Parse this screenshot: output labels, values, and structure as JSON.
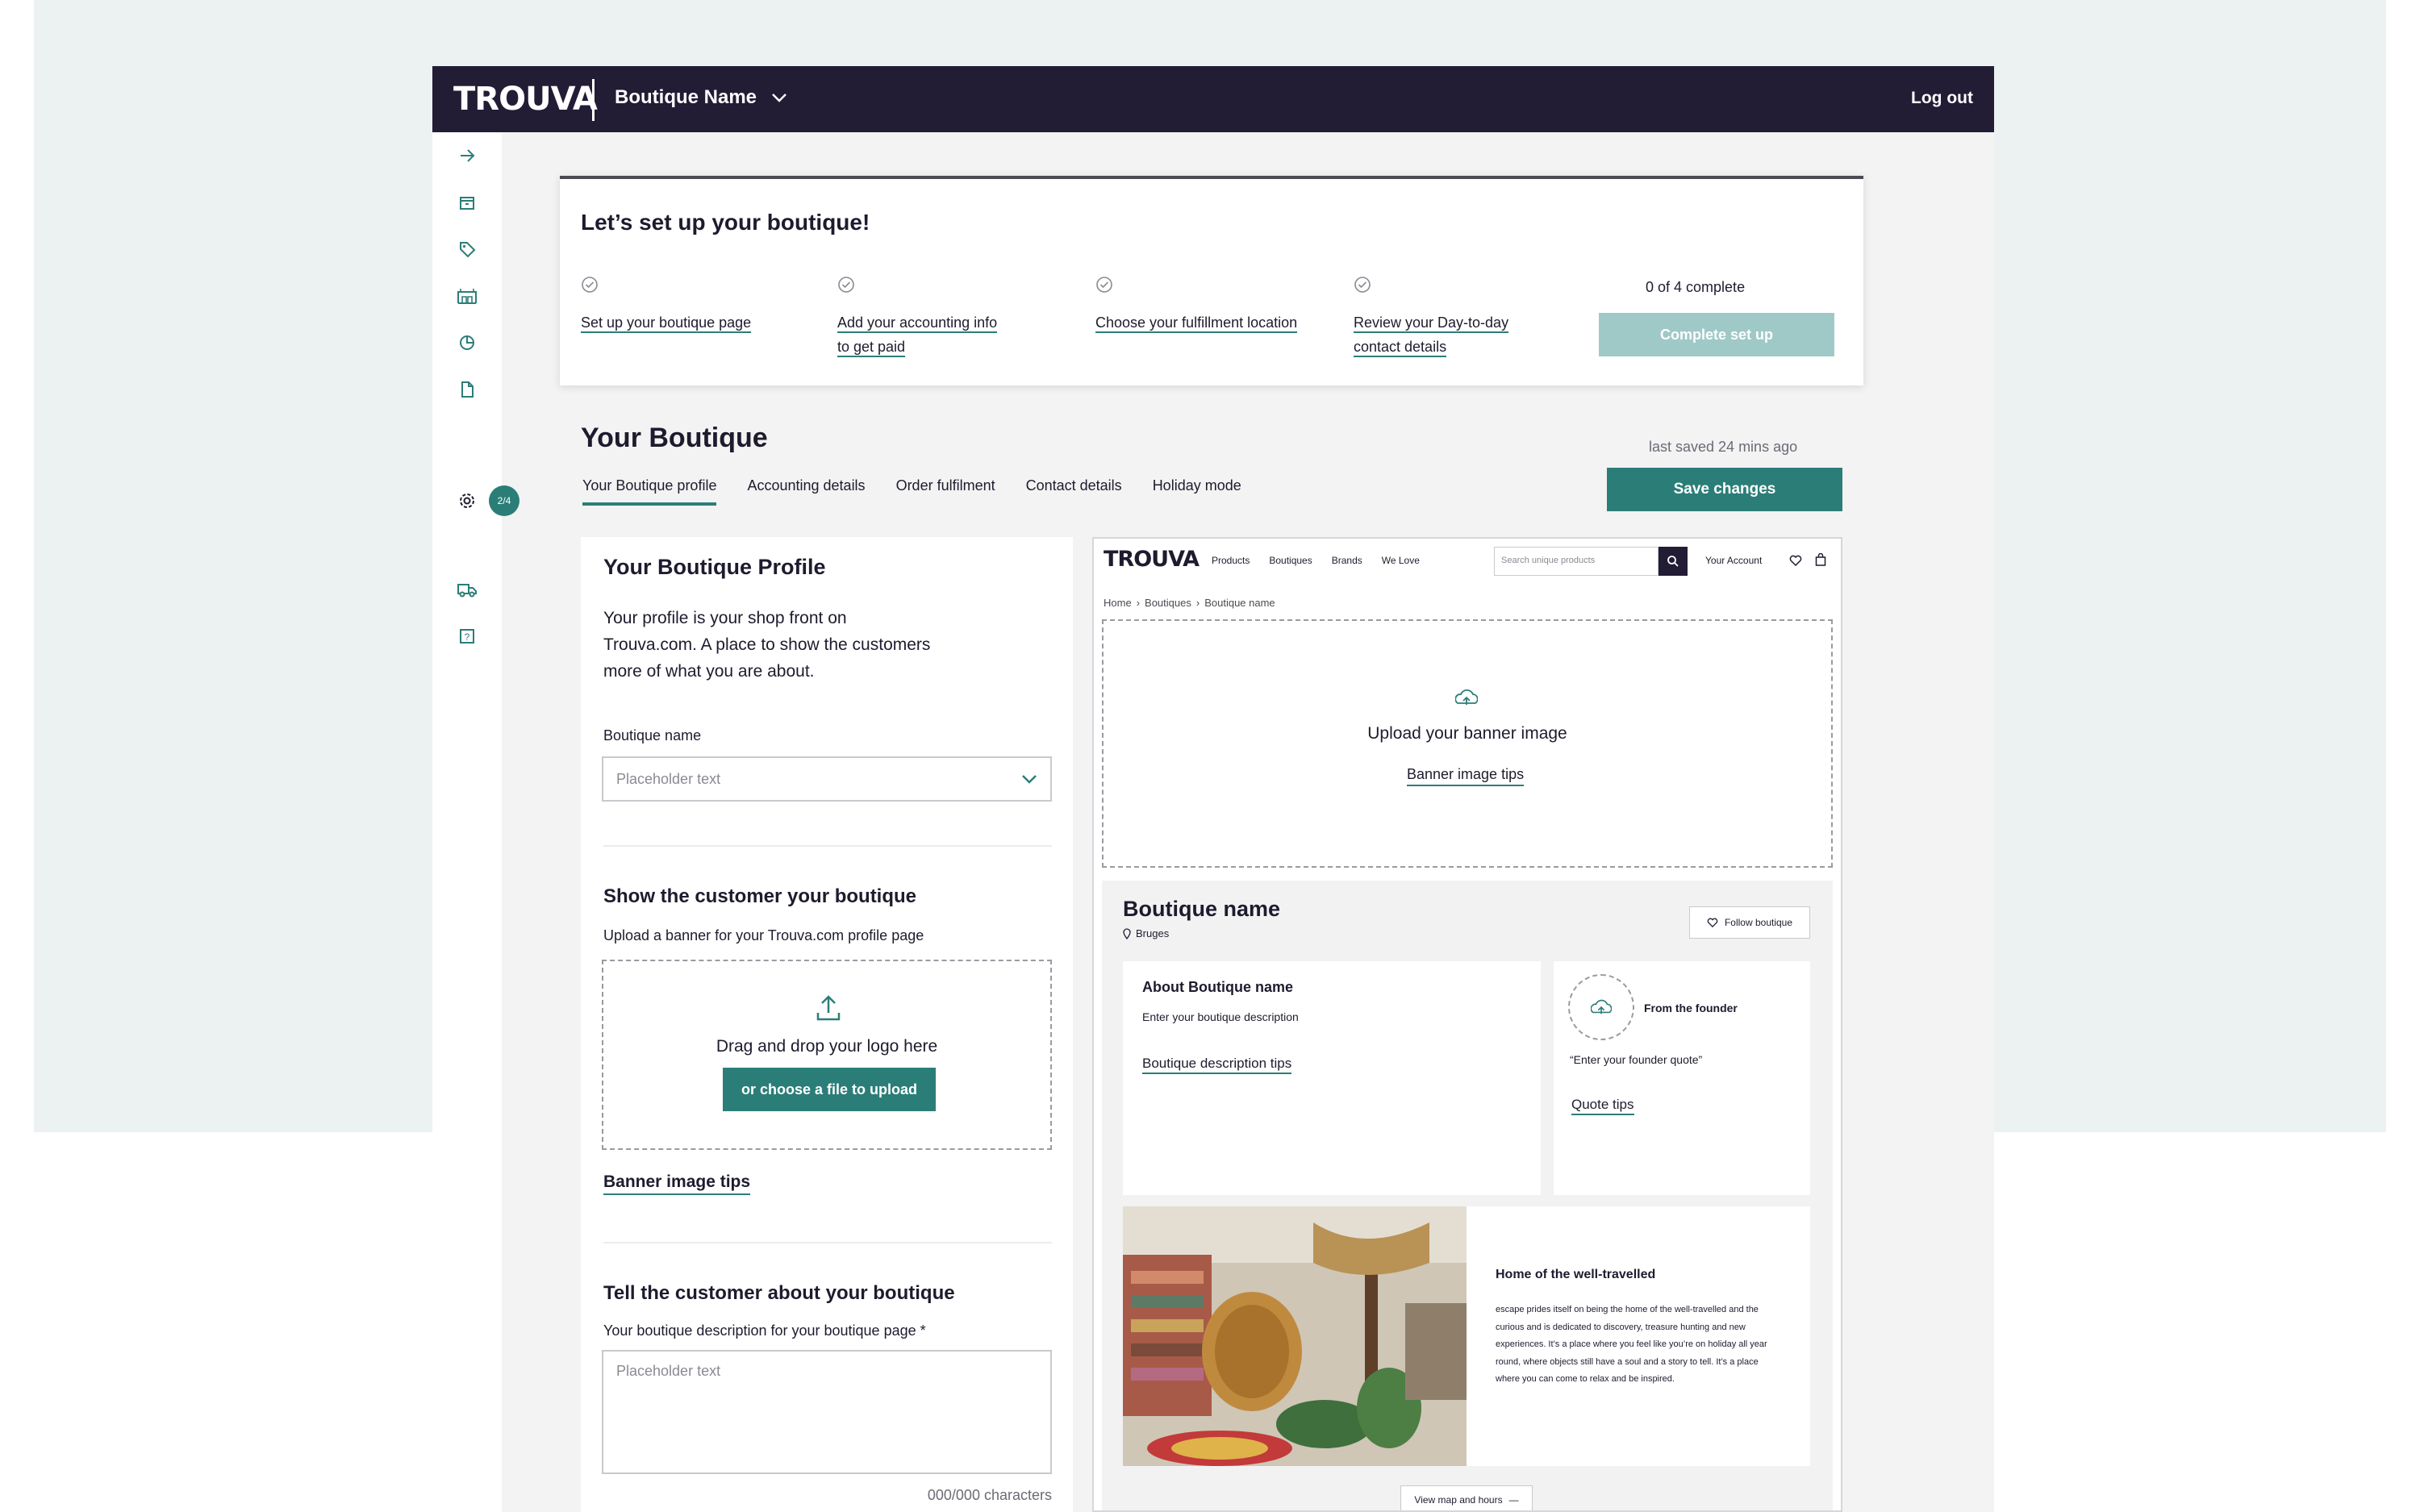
{
  "topbar": {
    "logo": "TROUVA",
    "boutique_selector": "Boutique Name",
    "logout": "Log out"
  },
  "sidebar": {
    "icons": [
      "arrow-right-icon",
      "storefront-icon",
      "tag-icon",
      "warehouse-icon",
      "pie-chart-icon",
      "document-icon",
      "gear-icon",
      "truck-icon",
      "help-icon"
    ],
    "badge": "2/4"
  },
  "setup": {
    "title": "Let’s set up your boutique!",
    "steps": [
      {
        "line1": "Set up your boutique page",
        "line2": ""
      },
      {
        "line1": "Add your accounting info",
        "line2": "to get paid"
      },
      {
        "line1": "Choose your fulfillment location",
        "line2": ""
      },
      {
        "line1": "Review your Day-to-day",
        "line2": "contact details"
      }
    ],
    "progress": "0 of 4 complete",
    "complete_button": "Complete set up"
  },
  "page": {
    "title": "Your Boutique",
    "last_saved": "last saved 24 mins ago",
    "save_button": "Save changes",
    "tabs": [
      "Your Boutique profile",
      "Accounting details",
      "Order fulfilment",
      "Contact details",
      "Holiday mode"
    ]
  },
  "form": {
    "title": "Your Boutique Profile",
    "intro": "Your profile is your shop front on Trouva.com. A place to show the customers more of what you are about.",
    "name_label": "Boutique name",
    "name_placeholder": "Placeholder text",
    "banner_heading": "Show the customer your boutique",
    "banner_sub": "Upload a banner for your Trouva.com profile page",
    "dropzone_text": "Drag and drop your logo here",
    "dropzone_button": "or choose a file to upload",
    "banner_tips": "Banner image tips",
    "desc_heading": "Tell the customer about your boutique",
    "desc_label": "Your boutique description for your boutique page *",
    "desc_placeholder": "Placeholder text",
    "char_count": "000/000 characters"
  },
  "preview": {
    "logo": "TROUVA",
    "nav_links": [
      "Products",
      "Boutiques",
      "Brands",
      "We Love"
    ],
    "search_placeholder": "Search unique products",
    "account": "Your Account",
    "breadcrumb": [
      "Home",
      "Boutiques",
      "Boutique name"
    ],
    "banner_upload": "Upload your banner image",
    "banner_tips": "Banner image tips",
    "boutique_name": "Boutique name",
    "location": "Bruges",
    "follow": "Follow boutique",
    "about_title": "About Boutique name",
    "about_placeholder": "Enter your boutique description",
    "about_tips": "Boutique description tips",
    "founder_title": "From the founder",
    "founder_quote": "“Enter your founder quote”",
    "quote_tips": "Quote tips",
    "story_title": "Home of the well-travelled",
    "story_text": "escape prides itself on being the home of the well-travelled and the curious and is dedicated to discovery, treasure hunting and new experiences. It’s a place where you feel like you’re on holiday all year round, where objects still have a soul and a story to tell. It’s a place where you can come to relax and be inspired.",
    "map_button": "View map and hours"
  },
  "colors": {
    "brand_dark": "#221c35",
    "accent": "#2b7e78",
    "accent_disabled": "#9fc9c6",
    "backdrop": "#ecf1f2"
  }
}
